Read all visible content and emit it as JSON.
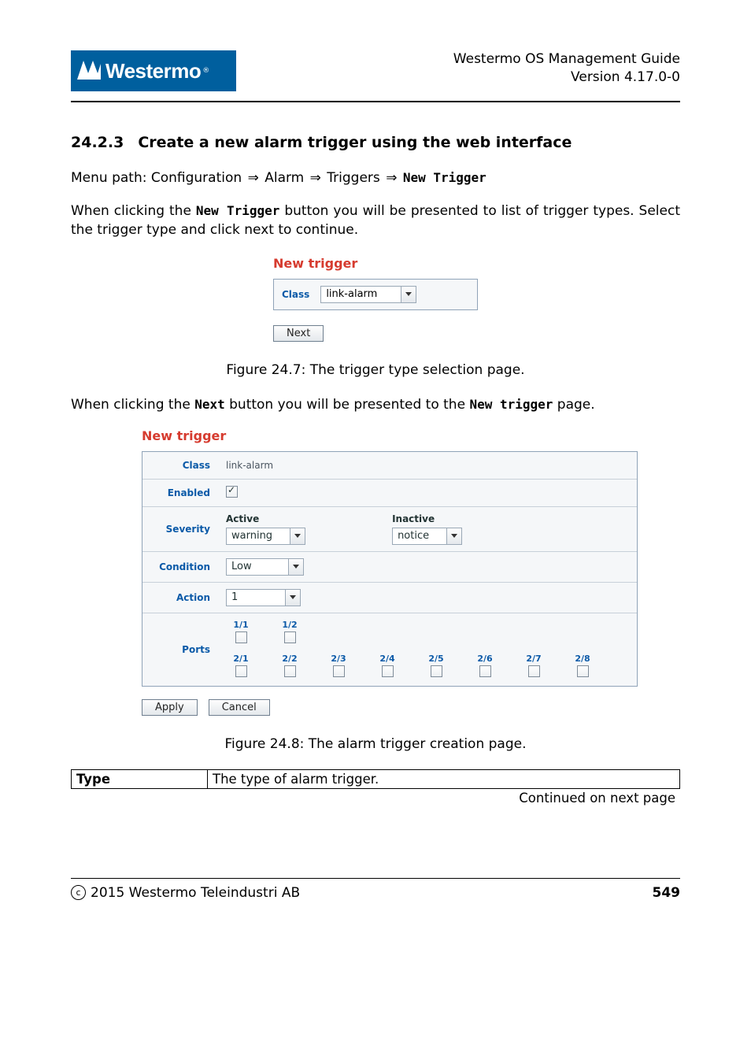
{
  "header": {
    "guide_title": "Westermo OS Management Guide",
    "version": "Version 4.17.0-0",
    "logo_text": "Westermo"
  },
  "section": {
    "number": "24.2.3",
    "title": "Create a new alarm trigger using the web interface"
  },
  "menu_path": {
    "prefix": "Menu path: Configuration ",
    "arrow": "⇒",
    "step2": " Alarm ",
    "step3": " Triggers ",
    "final_code": "New Trigger"
  },
  "para1_a": "When clicking the ",
  "para1_code": "New Trigger",
  "para1_b": " button you will be presented to list of trigger types. Select the trigger type and click next to continue.",
  "fig1": {
    "panel_title": "New trigger",
    "class_label": "Class",
    "class_value": "link-alarm",
    "next_btn": "Next"
  },
  "fig1_caption": "Figure 24.7: The trigger type selection page.",
  "para2_a": "When clicking the ",
  "para2_code1": "Next",
  "para2_b": " button you will be presented to the ",
  "para2_code2": "New trigger",
  "para2_c": " page.",
  "fig2": {
    "panel_title": "New trigger",
    "labels": {
      "class": "Class",
      "enabled": "Enabled",
      "severity": "Severity",
      "condition": "Condition",
      "action": "Action",
      "ports": "Ports"
    },
    "class_value": "link-alarm",
    "enabled_checked": true,
    "severity": {
      "active_label": "Active",
      "active_value": "warning",
      "inactive_label": "Inactive",
      "inactive_value": "notice"
    },
    "condition_value": "Low",
    "action_value": "1",
    "ports_row1": [
      "1/1",
      "1/2"
    ],
    "ports_row2": [
      "2/1",
      "2/2",
      "2/3",
      "2/4",
      "2/5",
      "2/6",
      "2/7",
      "2/8"
    ],
    "apply_btn": "Apply",
    "cancel_btn": "Cancel"
  },
  "fig2_caption": "Figure 24.8: The alarm trigger creation page.",
  "type_table": {
    "col0": "Type",
    "col1": "The type of alarm trigger.",
    "cont": "Continued on next page"
  },
  "footer": {
    "copyright_text": "2015 Westermo Teleindustri AB",
    "copy_symbol": "c",
    "page": "549"
  }
}
